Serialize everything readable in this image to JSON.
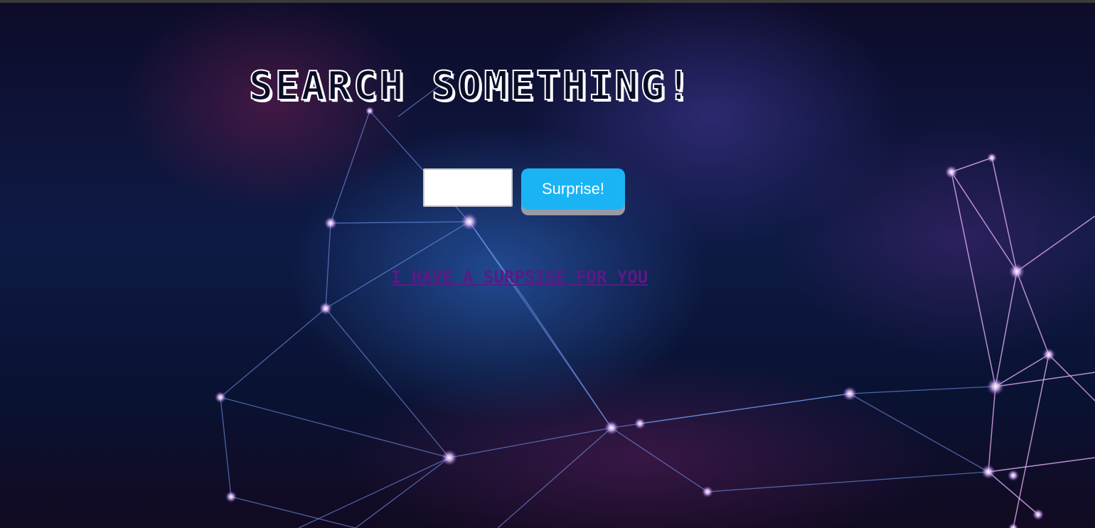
{
  "page": {
    "title": "Search Something!",
    "link_text": "I have a surpsise for you"
  },
  "search": {
    "value": "",
    "placeholder": "",
    "button_label": "Surprise!"
  },
  "colors": {
    "button_bg": "#1ab4f5",
    "button_shadow": "#9a9aa6",
    "link": "#5a1a86",
    "title_fill": "#0b0d28",
    "title_outline": "#ffffff"
  },
  "background": {
    "icon": "network-plexus-image"
  }
}
